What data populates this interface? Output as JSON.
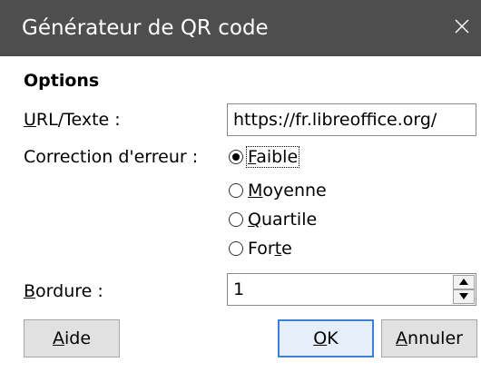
{
  "window": {
    "title": "Générateur de QR code",
    "close_icon": "close-icon"
  },
  "options": {
    "heading": "Options",
    "url_label_u": "U",
    "url_label_rest": "RL/Texte :",
    "url_value": "https://fr.libreoffice.org/",
    "correction_label": "Correction d'erreur :",
    "radios": [
      {
        "prefix": "",
        "u": "F",
        "rest": "aible",
        "selected": true
      },
      {
        "prefix": "",
        "u": "M",
        "rest": "oyenne",
        "selected": false
      },
      {
        "prefix": "",
        "u": "Q",
        "rest": "uartile",
        "selected": false
      },
      {
        "prefix": "For",
        "u": "t",
        "rest": "e",
        "selected": false
      }
    ],
    "border_label_u": "B",
    "border_label_rest": "ordure :",
    "border_value": "1"
  },
  "buttons": {
    "help_u": "A",
    "help_rest": "ide",
    "ok_u": "O",
    "ok_rest": "K",
    "cancel_u": "A",
    "cancel_rest": "nnuler"
  },
  "colors": {
    "titlebar": "#4e4e4e",
    "focus_border": "#3c7fd6"
  }
}
